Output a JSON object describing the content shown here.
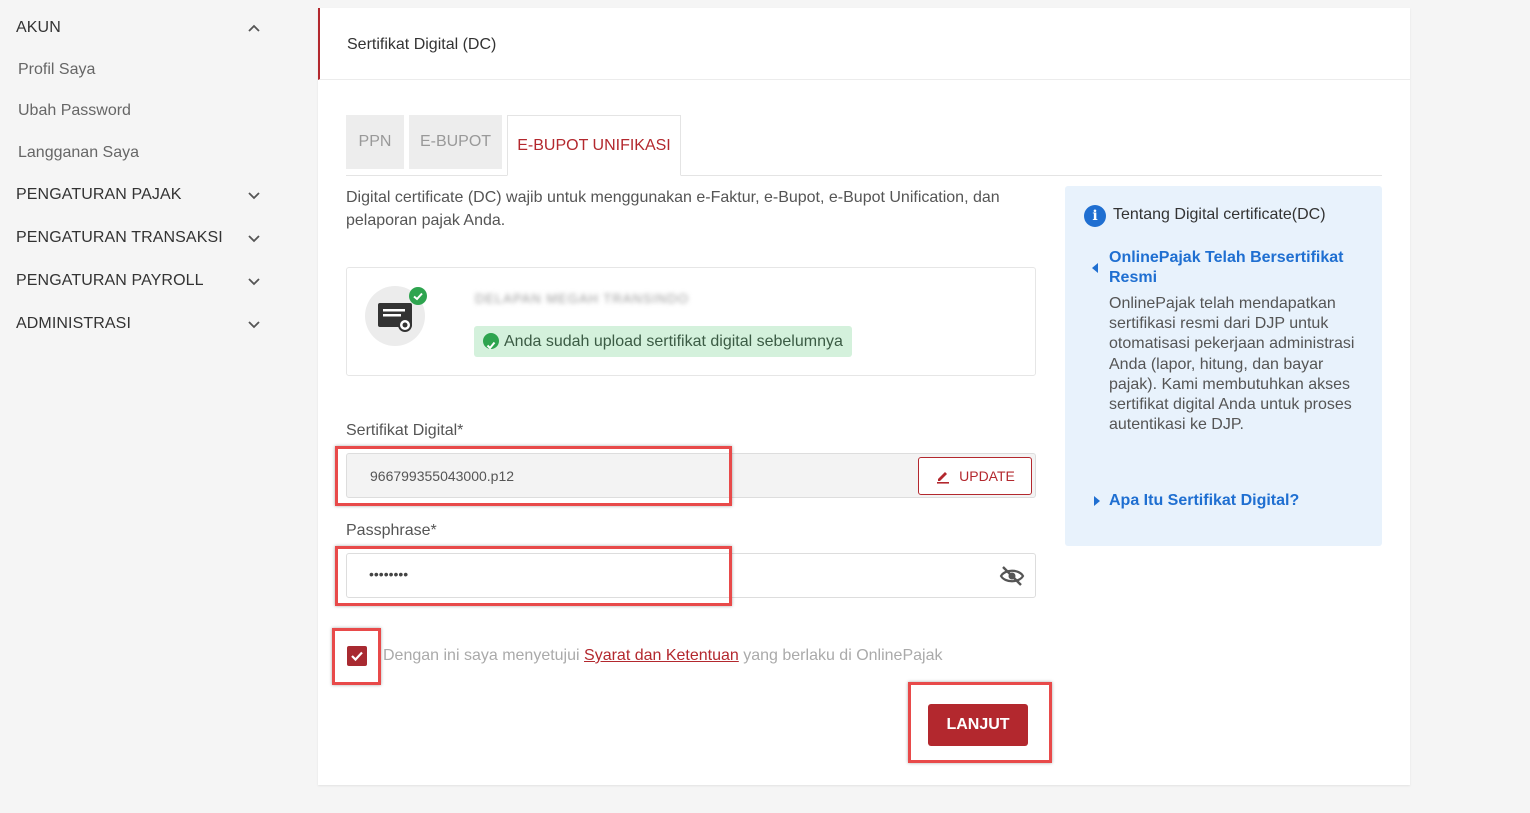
{
  "sidebar": {
    "sections": [
      {
        "label": "AKUN",
        "expanded": true,
        "items": [
          "Profil Saya",
          "Ubah Password",
          "Langganan Saya"
        ]
      },
      {
        "label": "PENGATURAN PAJAK",
        "expanded": false
      },
      {
        "label": "PENGATURAN TRANSAKSI",
        "expanded": false
      },
      {
        "label": "PENGATURAN PAYROLL",
        "expanded": false
      },
      {
        "label": "ADMINISTRASI",
        "expanded": false
      }
    ]
  },
  "card": {
    "title": "Sertifikat Digital (DC)"
  },
  "tabs": [
    {
      "label": "PPN",
      "active": false
    },
    {
      "label": "E-BUPOT",
      "active": false
    },
    {
      "label": "E-BUPOT UNIFIKASI",
      "active": true
    }
  ],
  "intro": "Digital certificate (DC) wajib untuk menggunakan e-Faktur, e-Bupot, e-Bupot Unification, dan pelaporan pajak Anda.",
  "certificate": {
    "company_name": "DELAPAN MEGAH TRANSINDO",
    "status": "Anda sudah upload sertifikat digital sebelumnya"
  },
  "form": {
    "cert_label": "Sertifikat Digital*",
    "cert_file": "966799355043000.p12",
    "update_label": "UPDATE",
    "pass_label": "Passphrase*",
    "pass_value": "••••••••",
    "agree_prefix": "Dengan ini saya menyetujui ",
    "agree_link": "Syarat dan Ketentuan",
    "agree_suffix": " yang berlaku di OnlinePajak",
    "agree_checked": true,
    "submit_label": "LANJUT"
  },
  "info": {
    "title": "Tentang Digital certificate(DC)",
    "heading": "OnlinePajak Telah Bersertifikat Resmi",
    "body": "OnlinePajak telah mendapatkan sertifikasi resmi dari DJP untuk otomatisasi pekerjaan administrasi Anda (lapor, hitung, dan bayar pajak). Kami membutuhkan akses sertifikat digital Anda untuk proses autentikasi ke DJP.",
    "link": "Apa Itu Sertifikat Digital?"
  },
  "colors": {
    "brand": "#b3282e",
    "info_blue": "#1f6fd1",
    "success": "#2ea44f",
    "annotation": "#e84a4a"
  }
}
